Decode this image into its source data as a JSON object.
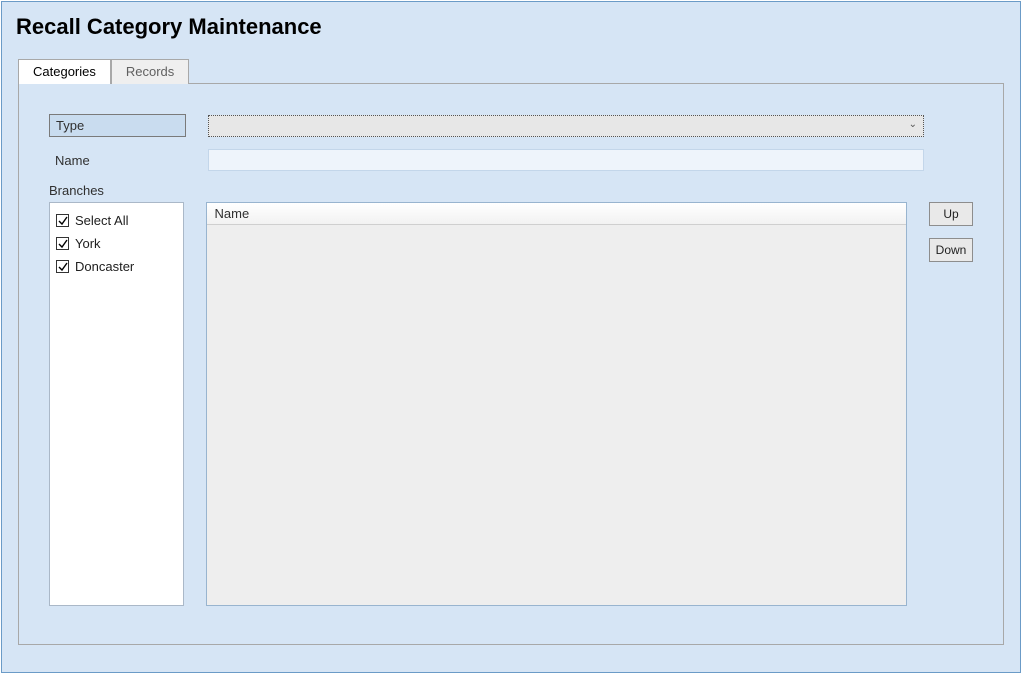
{
  "page": {
    "title": "Recall Category Maintenance"
  },
  "tabs": [
    {
      "label": "Categories",
      "active": true
    },
    {
      "label": "Records",
      "active": false
    }
  ],
  "form": {
    "type_label": "Type",
    "type_value": "",
    "name_label": "Name",
    "name_value": "",
    "branches_label": "Branches"
  },
  "branches": [
    {
      "label": "Select All",
      "checked": true
    },
    {
      "label": "York",
      "checked": true
    },
    {
      "label": "Doncaster",
      "checked": true
    }
  ],
  "grid": {
    "header": "Name"
  },
  "buttons": {
    "up": "Up",
    "down": "Down"
  }
}
